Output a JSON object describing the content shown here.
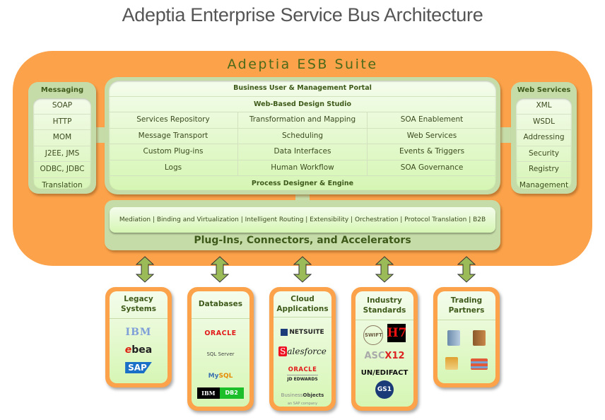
{
  "title": "Adeptia Enterprise Service Bus Architecture",
  "suite": {
    "title": "Adeptia ESB Suite",
    "messaging": {
      "title": "Messaging",
      "items": [
        "SOAP",
        "HTTP",
        "MOM",
        "J2EE, JMS",
        "ODBC, JDBC",
        "Translation"
      ]
    },
    "web_services": {
      "title": "Web Services",
      "items": [
        "XML",
        "WSDL",
        "Addressing",
        "Security",
        "Registry",
        "Management"
      ]
    },
    "core": {
      "header_rows": [
        "Business User & Management Portal",
        "Web-Based Design Studio"
      ],
      "grid": [
        [
          "Services Repository",
          "Transformation and Mapping",
          "SOA Enablement"
        ],
        [
          "Message Transport",
          "Scheduling",
          "Web Services"
        ],
        [
          "Custom Plug-ins",
          "Data Interfaces",
          "Events & Triggers"
        ],
        [
          "Logs",
          "Human Workflow",
          "SOA Governance"
        ]
      ],
      "footer_row": "Process Designer & Engine"
    },
    "plugins": {
      "capabilities": "Mediation | Binding and Virtualization | Intelligent Routing | Extensibility | Orchestration | Protocol Translation | B2B",
      "title": "Plug-Ins, Connectors, and Accelerators"
    }
  },
  "external": [
    {
      "title": "Legacy Systems",
      "logos": [
        "IBM",
        "bea",
        "SAP"
      ]
    },
    {
      "title": "Databases",
      "logos": [
        "ORACLE",
        "SQL Server",
        "MySQL",
        "IBM DB2"
      ]
    },
    {
      "title": "Cloud Applications",
      "logos": [
        "NETSUITE",
        "salesforce",
        "ORACLE JD EDWARDS",
        "BusinessObjects an SAP company"
      ]
    },
    {
      "title": "Industry Standards",
      "logos": [
        "SWIFT",
        "HL7",
        "ASC X12",
        "UN/EDIFACT",
        "GS1"
      ]
    },
    {
      "title": "Trading Partners",
      "logos": [
        "office-tower-icon",
        "brick-building-icon",
        "bank-icon",
        "warehouse-icon"
      ]
    }
  ],
  "labels": {
    "ibm": "IBM",
    "bea_e": "e",
    "bea_b": "b",
    "bea_a": "a",
    "sap": "SAP",
    "oracle": "ORACLE",
    "sql": "SQL Server",
    "mysql_my": "My",
    "mysql_sql": "SQL",
    "db2_ibm": "IBM",
    "db2": "DB2",
    "netsuite": "NETSUITE",
    "sf_s": "S",
    "sf_rest": "alesforce",
    "jde": "JD EDWARDS",
    "bo_business": "Business",
    "bo_objects": "Objects",
    "bo_sub": "an SAP company",
    "swift": "SWIFT",
    "hl7": "H7",
    "asc": "ASC",
    "x12": "X12",
    "edifact": "UN/EDIFACT",
    "gs1": "GS1"
  },
  "colors": {
    "suite_orange": "#fca24a",
    "panel_green": "#c6dca8",
    "text_dark_green": "#3e5a1a",
    "arrow_green": "#9bbb59"
  }
}
